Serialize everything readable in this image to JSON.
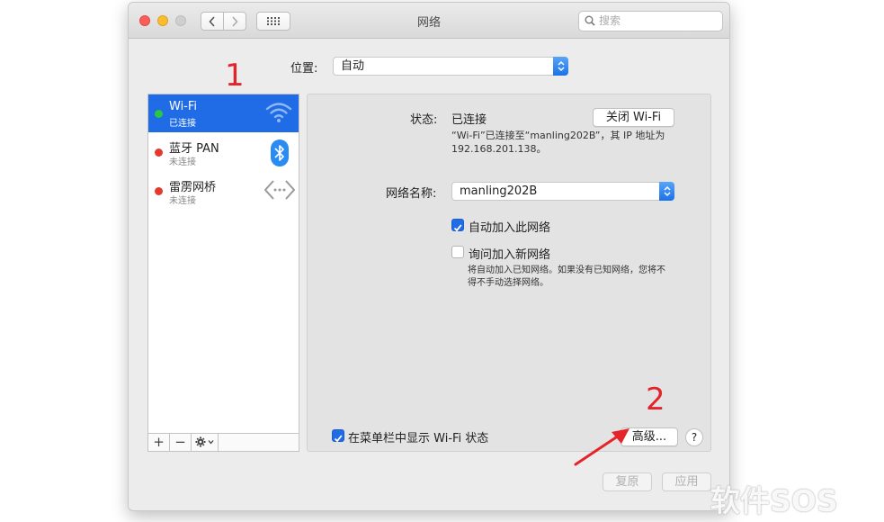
{
  "window": {
    "title": "网络",
    "search_placeholder": "搜索"
  },
  "location": {
    "label": "位置:",
    "value": "自动"
  },
  "services": [
    {
      "name": "Wi-Fi",
      "status": "已连接",
      "status_color": "#28c840",
      "selected": true,
      "icon": "wifi-icon"
    },
    {
      "name": "蓝牙 PAN",
      "status": "未连接",
      "status_color": "#e23b2e",
      "selected": false,
      "icon": "bluetooth-icon"
    },
    {
      "name": "雷雳网桥",
      "status": "未连接",
      "status_color": "#e23b2e",
      "selected": false,
      "icon": "thunderbolt-bridge-icon"
    }
  ],
  "sidebar_tools": {
    "add": "+",
    "remove": "−"
  },
  "detail": {
    "status_label": "状态:",
    "status_value": "已连接",
    "toggle_button": "关闭 Wi-Fi",
    "status_desc_line1": "“Wi-Fi”已连接至“manling202B”，其 IP 地址为",
    "status_desc_line2": "192.168.201.138。",
    "network_name_label": "网络名称:",
    "network_name_value": "manling202B",
    "auto_join_label": "自动加入此网络",
    "auto_join_checked": true,
    "ask_join_label": "询问加入新网络",
    "ask_join_checked": false,
    "ask_desc_line1": "将自动加入已知网络。如果没有已知网络，您将不",
    "ask_desc_line2": "得不手动选择网络。",
    "show_menubar_label": "在菜单栏中显示 Wi-Fi 状态",
    "show_menubar_checked": true,
    "advanced_button": "高级...",
    "help_button": "?"
  },
  "bottom": {
    "revert_button": "复原",
    "apply_button": "应用"
  },
  "annotations": {
    "marker1": "1",
    "marker2": "2",
    "color": "#e4242a"
  },
  "watermark": "软件SOS",
  "colors": {
    "accent": "#1f6ce6"
  }
}
